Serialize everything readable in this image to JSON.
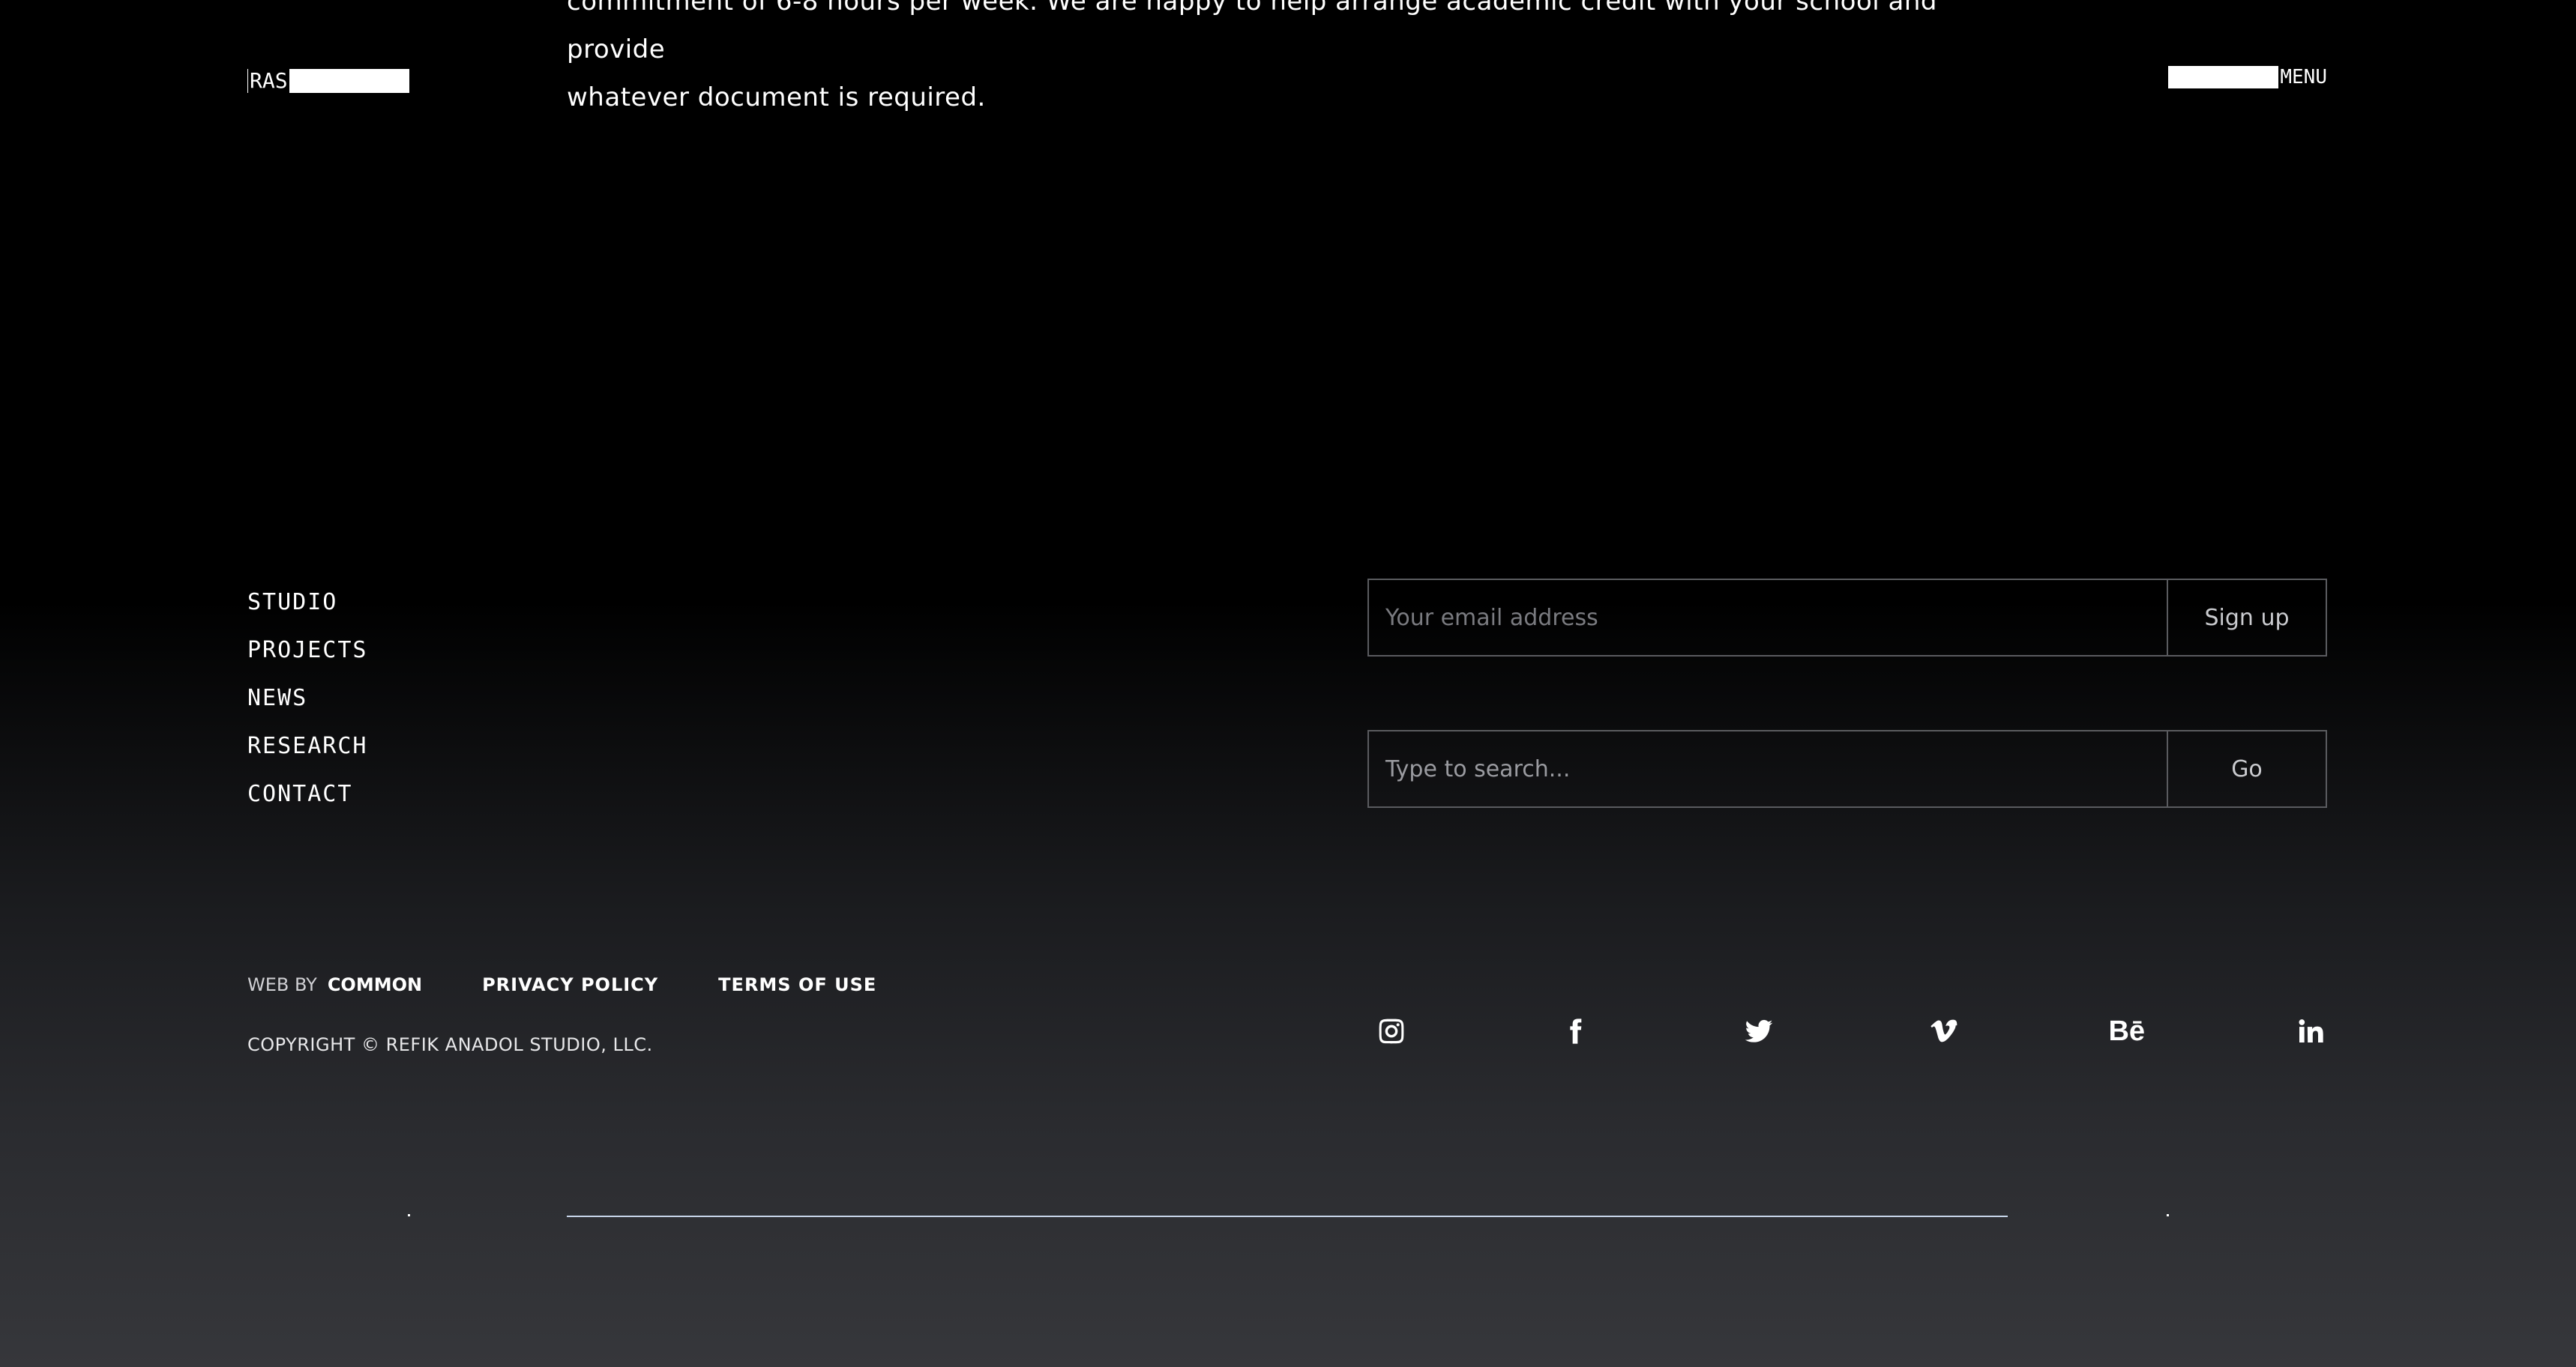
{
  "intro": {
    "line1": "commitment of 6-8 hours per week. We are happy to help arrange academic credit with your school and provide",
    "line2": "whatever document is required."
  },
  "header": {
    "logo": "RAS",
    "menu_label": "MENU"
  },
  "nav": {
    "items": [
      "STUDIO",
      "PROJECTS",
      "NEWS",
      "RESEARCH",
      "CONTACT"
    ]
  },
  "newsletter": {
    "placeholder": "Your email address",
    "button": "Sign up"
  },
  "search": {
    "placeholder": "Type to search...",
    "button": "Go"
  },
  "footer": {
    "web_by": "WEB BY",
    "web_by_name": "COMMON",
    "privacy": "PRIVACY POLICY",
    "terms": "TERMS OF USE",
    "copyright": "COPYRIGHT © REFIK ANADOL STUDIO, LLC."
  },
  "socials": {
    "behance_text": "Bē",
    "icons": [
      "instagram-icon",
      "facebook-icon",
      "twitter-icon",
      "vimeo-icon",
      "behance-icon",
      "linkedin-icon"
    ]
  }
}
